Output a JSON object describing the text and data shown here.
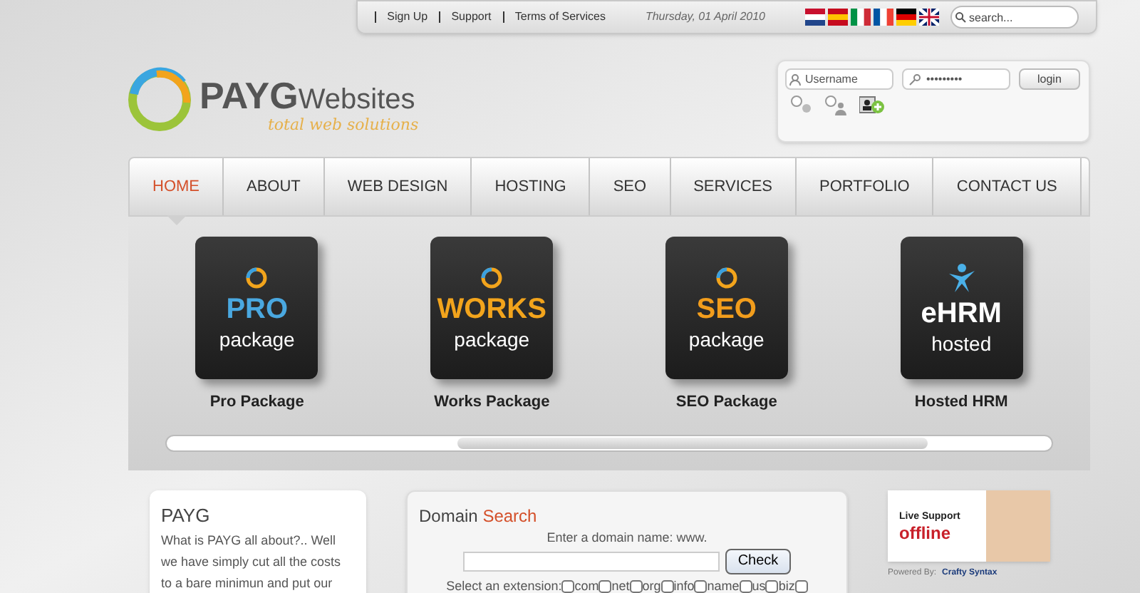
{
  "top_bar": {
    "links": [
      "Sign Up",
      "Support",
      "Terms of Services"
    ],
    "date": "Thursday, 01 April 2010",
    "flags": [
      {
        "kind": "nl"
      },
      {
        "kind": "es"
      },
      {
        "kind": "it"
      },
      {
        "kind": "fr"
      },
      {
        "kind": "de"
      },
      {
        "kind": "uk"
      }
    ],
    "search": {
      "placeholder": "search..."
    }
  },
  "logo": {
    "brand": "PAYG",
    "brand_suffix": "Websites",
    "tagline": "total web solutions"
  },
  "login": {
    "username_placeholder": "Username",
    "password_value": "•••••••••",
    "button": "login"
  },
  "nav": [
    {
      "label": "HOME",
      "selected": true
    },
    {
      "label": "ABOUT",
      "selected": false
    },
    {
      "label": "WEB DESIGN",
      "selected": false
    },
    {
      "label": "HOSTING",
      "selected": false
    },
    {
      "label": "SEO",
      "selected": false
    },
    {
      "label": "SERVICES",
      "selected": false
    },
    {
      "label": "PORTFOLIO",
      "selected": false
    },
    {
      "label": "CONTACT US",
      "selected": false
    }
  ],
  "packages": [
    {
      "kind": "pro",
      "title": "PRO",
      "subtitle": "package",
      "caption": "Pro Package"
    },
    {
      "kind": "works",
      "title": "WORKS",
      "subtitle": "package",
      "caption": "Works Package"
    },
    {
      "kind": "seo",
      "title": "SEO",
      "subtitle": "package",
      "caption": "SEO Package"
    },
    {
      "kind": "ehrm",
      "title": "eHRM",
      "subtitle": "hosted",
      "caption": "Hosted HRM"
    }
  ],
  "about": {
    "title": "PAYG",
    "text": "What is PAYG all about?.. Well we have simply cut all the costs to a bare minimun and put our"
  },
  "domain": {
    "title": "Domain",
    "title_accent": "Search",
    "prompt": "Enter a domain name: www.",
    "button": "Check",
    "extension_label": "Select an extension:",
    "extensions": [
      {
        "label": "com",
        "checked": false
      },
      {
        "label": "net",
        "checked": false
      },
      {
        "label": "org",
        "checked": false
      },
      {
        "label": "info",
        "checked": false
      },
      {
        "label": "name",
        "checked": false
      },
      {
        "label": "us",
        "checked": false
      },
      {
        "label": "biz",
        "checked": false
      }
    ],
    "trailing_checkbox": {
      "checked": false
    }
  },
  "live_support": {
    "title": "Live Support",
    "status": "offline",
    "powered_label": "Powered By:",
    "powered_brand": "Crafty Syntax"
  }
}
